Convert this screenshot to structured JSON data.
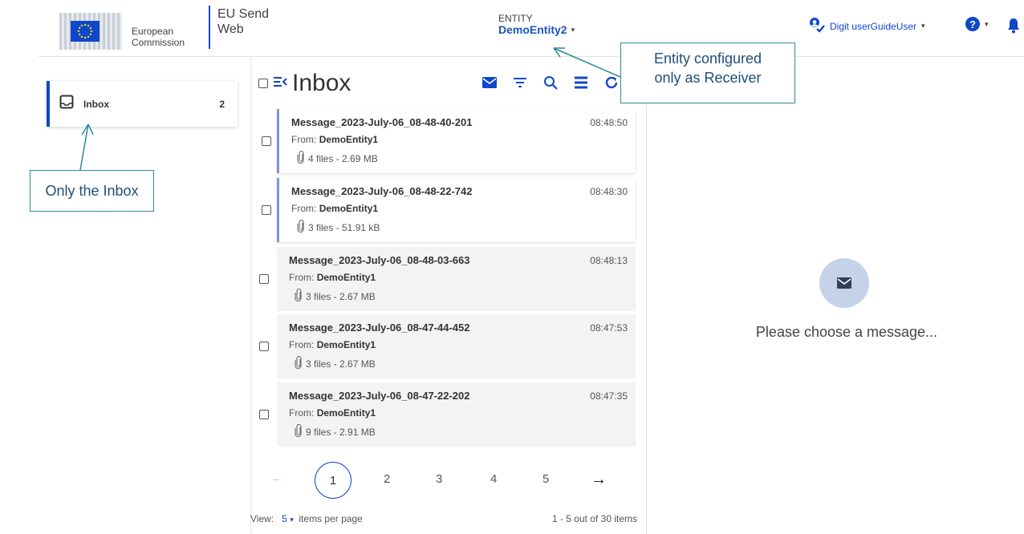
{
  "header": {
    "logo_line1": "European",
    "logo_line2": "Commission",
    "app_title_line1": "EU Send",
    "app_title_line2": "Web",
    "entity_label": "ENTITY",
    "entity_name": "DemoEntity2",
    "user_name": "Digit userGuideUser"
  },
  "sidebar": {
    "items": [
      {
        "label": "Inbox",
        "count": "2"
      }
    ]
  },
  "main": {
    "title": "Inbox",
    "messages": [
      {
        "subject": "Message_2023-July-06_08-48-40-201",
        "time": "08:48:50",
        "from_prefix": "From:",
        "from": "DemoEntity1",
        "files": "4 files - 2.69 MB",
        "unread": true
      },
      {
        "subject": "Message_2023-July-06_08-48-22-742",
        "time": "08:48:30",
        "from_prefix": "From:",
        "from": "DemoEntity1",
        "files": "3 files - 51.91 kB",
        "unread": true
      },
      {
        "subject": "Message_2023-July-06_08-48-03-663",
        "time": "08:48:13",
        "from_prefix": "From:",
        "from": "DemoEntity1",
        "files": "3 files - 2.67 MB",
        "unread": false
      },
      {
        "subject": "Message_2023-July-06_08-47-44-452",
        "time": "08:47:53",
        "from_prefix": "From:",
        "from": "DemoEntity1",
        "files": "3 files - 2.67 MB",
        "unread": false
      },
      {
        "subject": "Message_2023-July-06_08-47-22-202",
        "time": "08:47:35",
        "from_prefix": "From:",
        "from": "DemoEntity1",
        "files": "9 files - 2.91 MB",
        "unread": false
      }
    ],
    "pagination": {
      "pages": [
        "1",
        "2",
        "3",
        "4",
        "5"
      ],
      "current": "1",
      "prev_arrow": "←",
      "next_arrow": "→"
    },
    "footer": {
      "view_label": "View:",
      "per_page": "5",
      "per_page_suffix": "items per page",
      "range_text": "1 - 5 out of 30 items"
    }
  },
  "detail": {
    "empty_text": "Please choose a message..."
  },
  "annotations": {
    "entity_line1": "Entity configured",
    "entity_line2": "only as Receiver",
    "inbox": "Only the Inbox"
  },
  "colors": {
    "brand_blue": "#0e47cb",
    "entity_blue": "#1a56b8",
    "annotation_border": "#2e8a9a",
    "annotation_text": "#1f4e79"
  }
}
